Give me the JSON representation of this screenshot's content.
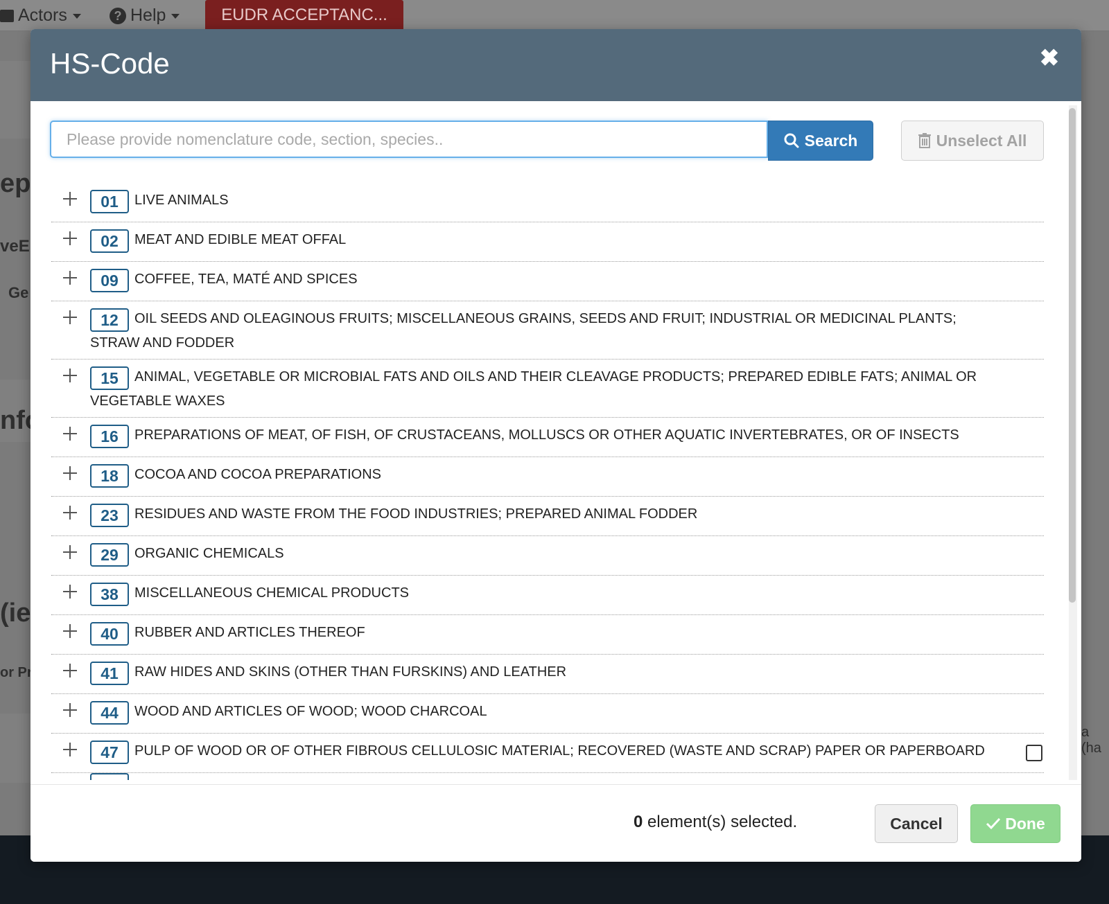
{
  "background": {
    "nav": {
      "actors_label": "Actors",
      "help_label": "Help",
      "eudr_label": "EUDR ACCEPTANC..."
    },
    "fragments": [
      "epi",
      "veE",
      "Ge",
      "nfo",
      "(ie",
      "or Pr",
      "a (ha"
    ]
  },
  "modal": {
    "title": "HS-Code",
    "search": {
      "placeholder": "Please provide nomenclature code, section, species..",
      "button_label": "Search"
    },
    "unselect_all_label": "Unselect All",
    "rows": [
      {
        "code": "01",
        "label": "LIVE ANIMALS"
      },
      {
        "code": "02",
        "label": "MEAT AND EDIBLE MEAT OFFAL"
      },
      {
        "code": "09",
        "label": "COFFEE, TEA, MATÉ AND SPICES"
      },
      {
        "code": "12",
        "label": "OIL SEEDS AND OLEAGINOUS FRUITS; MISCELLANEOUS GRAINS, SEEDS AND FRUIT; INDUSTRIAL OR MEDICINAL PLANTS; STRAW AND FODDER"
      },
      {
        "code": "15",
        "label": "ANIMAL, VEGETABLE OR MICROBIAL FATS AND OILS AND THEIR CLEAVAGE PRODUCTS; PREPARED EDIBLE FATS; ANIMAL OR VEGETABLE WAXES"
      },
      {
        "code": "16",
        "label": "PREPARATIONS OF MEAT, OF FISH, OF CRUSTACEANS, MOLLUSCS OR OTHER AQUATIC INVERTEBRATES, OR OF INSECTS"
      },
      {
        "code": "18",
        "label": "COCOA AND COCOA PREPARATIONS"
      },
      {
        "code": "23",
        "label": "RESIDUES AND WASTE FROM THE FOOD INDUSTRIES; PREPARED ANIMAL FODDER"
      },
      {
        "code": "29",
        "label": "ORGANIC CHEMICALS"
      },
      {
        "code": "38",
        "label": "MISCELLANEOUS CHEMICAL PRODUCTS"
      },
      {
        "code": "40",
        "label": "RUBBER AND ARTICLES THEREOF"
      },
      {
        "code": "41",
        "label": "RAW HIDES AND SKINS (OTHER THAN FURSKINS) AND LEATHER"
      },
      {
        "code": "44",
        "label": "WOOD AND ARTICLES OF WOOD; WOOD CHARCOAL"
      },
      {
        "code": "47",
        "label": "PULP OF WOOD OR OF OTHER FIBROUS CELLULOSIC MATERIAL; RECOVERED (WASTE AND SCRAP) PAPER OR PAPERBOARD"
      }
    ],
    "footer": {
      "selected_count": "0",
      "selected_text": "element(s) selected.",
      "cancel_label": "Cancel",
      "done_label": "Done"
    }
  },
  "colors": {
    "header_bg": "#546a7b",
    "primary": "#337ab7",
    "code_badge": "#1f5d87",
    "done_disabled": "#90d890",
    "eudr_tab": "#7a1f1f"
  },
  "icons": {
    "search": "search-icon",
    "unselect": "trash-icon",
    "close": "close-icon",
    "done": "check-icon",
    "expand": "plus-icon"
  }
}
